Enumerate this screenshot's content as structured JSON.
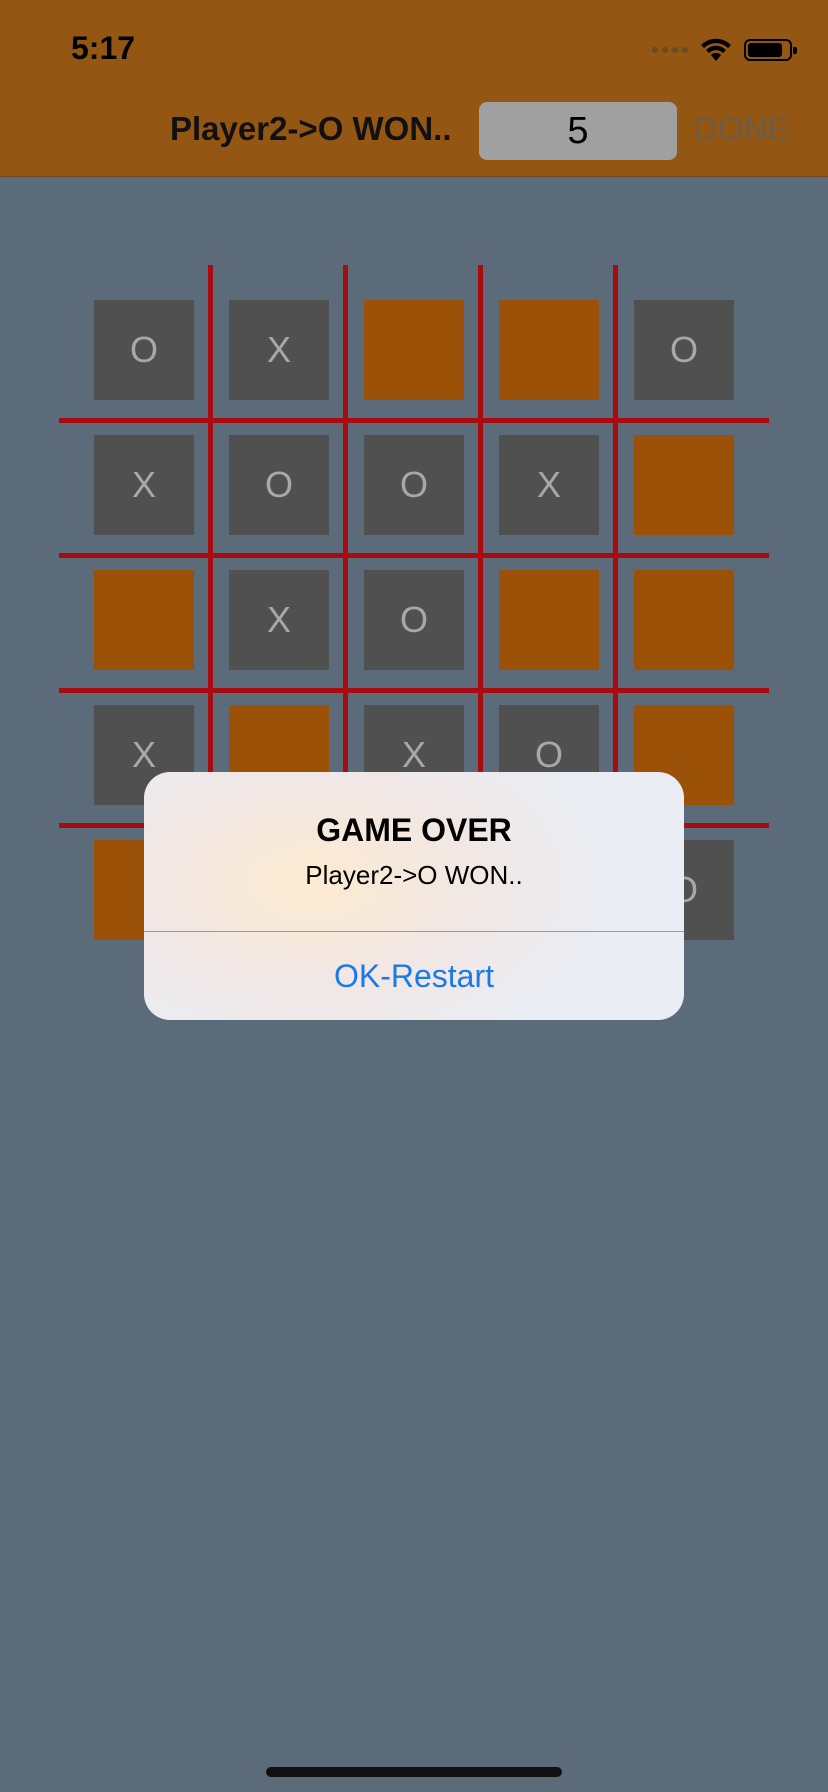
{
  "status_bar": {
    "time": "5:17"
  },
  "header": {
    "status_text": "Player2->O WON..",
    "size_value": "5",
    "done_label": "DONE"
  },
  "board": {
    "rows": [
      [
        "O",
        "X",
        "",
        "",
        "O"
      ],
      [
        "X",
        "O",
        "O",
        "X",
        ""
      ],
      [
        "",
        "X",
        "O",
        "",
        ""
      ],
      [
        "X",
        "",
        "X",
        "O",
        ""
      ],
      [
        "",
        "",
        "",
        "",
        "O"
      ]
    ]
  },
  "alert": {
    "title": "GAME OVER",
    "message": "Player2->O WON..",
    "button_label": "OK-Restart"
  },
  "colors": {
    "header_bg": "#945613",
    "page_bg": "#5c6b7a",
    "grid_line": "#a80b10",
    "filled_cell": "#505050",
    "empty_cell": "#9b5208",
    "accent_blue": "#1a7ae8"
  }
}
